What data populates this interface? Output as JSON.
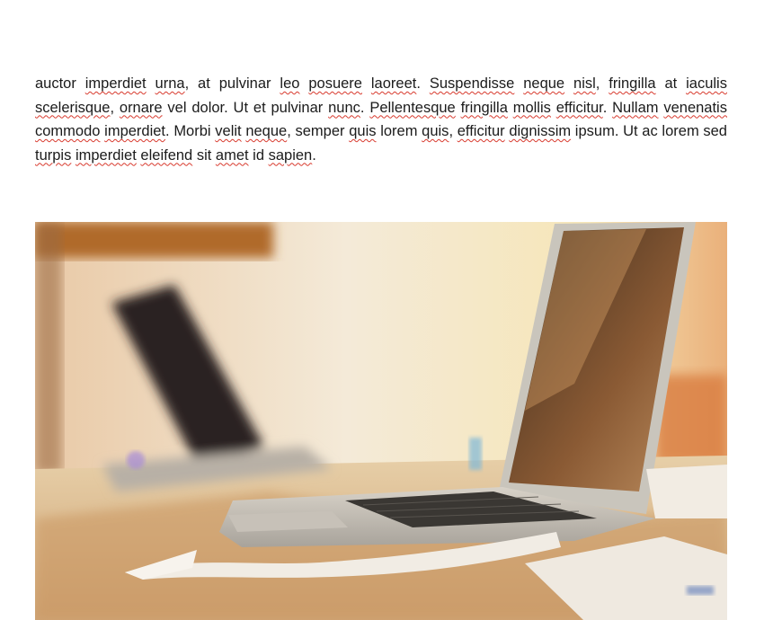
{
  "document": {
    "paragraph_segments": [
      {
        "text": "auctor ",
        "misspelled": false
      },
      {
        "text": "imperdiet",
        "misspelled": true
      },
      {
        "text": " ",
        "misspelled": false
      },
      {
        "text": "urna",
        "misspelled": true
      },
      {
        "text": ", at pulvinar ",
        "misspelled": false
      },
      {
        "text": "leo",
        "misspelled": true
      },
      {
        "text": " ",
        "misspelled": false
      },
      {
        "text": "posuere",
        "misspelled": true
      },
      {
        "text": " ",
        "misspelled": false
      },
      {
        "text": "laoreet",
        "misspelled": true
      },
      {
        "text": ". ",
        "misspelled": false
      },
      {
        "text": "Suspendisse",
        "misspelled": true
      },
      {
        "text": " ",
        "misspelled": false
      },
      {
        "text": "neque",
        "misspelled": true
      },
      {
        "text": " ",
        "misspelled": false
      },
      {
        "text": "nisl",
        "misspelled": true
      },
      {
        "text": ", ",
        "misspelled": false
      },
      {
        "text": "fringilla",
        "misspelled": true
      },
      {
        "text": " at ",
        "misspelled": false
      },
      {
        "text": "iaculis",
        "misspelled": true
      },
      {
        "text": " ",
        "misspelled": false
      },
      {
        "text": "scelerisque",
        "misspelled": true
      },
      {
        "text": ", ",
        "misspelled": false
      },
      {
        "text": "ornare",
        "misspelled": true
      },
      {
        "text": " vel dolor. Ut et pulvinar ",
        "misspelled": false
      },
      {
        "text": "nunc",
        "misspelled": true
      },
      {
        "text": ". ",
        "misspelled": false
      },
      {
        "text": "Pellentesque",
        "misspelled": true
      },
      {
        "text": " ",
        "misspelled": false
      },
      {
        "text": "fringilla",
        "misspelled": true
      },
      {
        "text": " ",
        "misspelled": false
      },
      {
        "text": "mollis",
        "misspelled": true
      },
      {
        "text": " ",
        "misspelled": false
      },
      {
        "text": "efficitur",
        "misspelled": true
      },
      {
        "text": ". ",
        "misspelled": false
      },
      {
        "text": "Nullam",
        "misspelled": true
      },
      {
        "text": " ",
        "misspelled": false
      },
      {
        "text": "venenatis",
        "misspelled": true
      },
      {
        "text": " ",
        "misspelled": false
      },
      {
        "text": "commodo",
        "misspelled": true
      },
      {
        "text": " ",
        "misspelled": false
      },
      {
        "text": "imperdiet",
        "misspelled": true
      },
      {
        "text": ". Morbi ",
        "misspelled": false
      },
      {
        "text": "velit",
        "misspelled": true
      },
      {
        "text": " ",
        "misspelled": false
      },
      {
        "text": "neque",
        "misspelled": true
      },
      {
        "text": ", semper ",
        "misspelled": false
      },
      {
        "text": "quis",
        "misspelled": true
      },
      {
        "text": " lorem ",
        "misspelled": false
      },
      {
        "text": "quis",
        "misspelled": true
      },
      {
        "text": ", ",
        "misspelled": false
      },
      {
        "text": "efficitur",
        "misspelled": true
      },
      {
        "text": " ",
        "misspelled": false
      },
      {
        "text": "dignissim",
        "misspelled": true
      },
      {
        "text": " ipsum. Ut ac lorem sed ",
        "misspelled": false
      },
      {
        "text": "turpis",
        "misspelled": true
      },
      {
        "text": " ",
        "misspelled": false
      },
      {
        "text": "imperdiet",
        "misspelled": true
      },
      {
        "text": " ",
        "misspelled": false
      },
      {
        "text": "eleifend",
        "misspelled": true
      },
      {
        "text": " sit ",
        "misspelled": false
      },
      {
        "text": "amet",
        "misspelled": true
      },
      {
        "text": " id ",
        "misspelled": false
      },
      {
        "text": "sapien",
        "misspelled": true
      },
      {
        "text": ".",
        "misspelled": false
      }
    ],
    "spellcheck_underline_color": "#d83a2e",
    "image": {
      "subject": "laptops on a wooden desk photo",
      "tint": "warm"
    }
  }
}
